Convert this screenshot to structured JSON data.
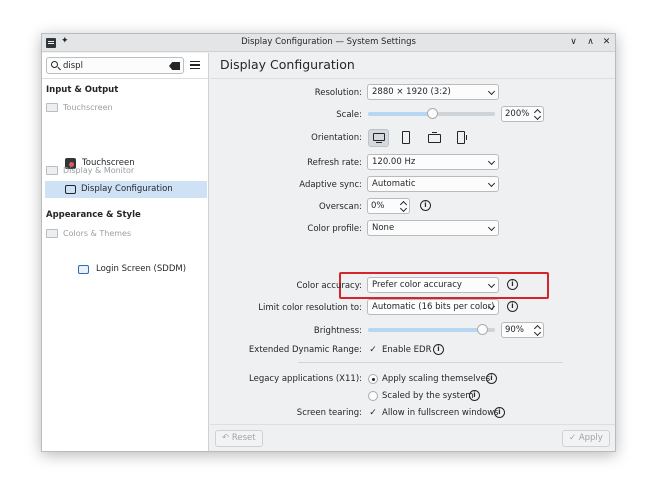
{
  "window": {
    "title": "Display Configuration — System Settings",
    "buttons": {
      "minimize": "∨",
      "maximize": "∧",
      "close": "✕"
    }
  },
  "sidebar": {
    "search_value": "displ",
    "categories": [
      {
        "label": "Input & Output"
      },
      {
        "label": "Appearance & Style"
      }
    ],
    "groups": [
      {
        "label": "Touchscreen"
      },
      {
        "label": "Display & Monitor"
      },
      {
        "label": "Colors & Themes"
      }
    ],
    "items": [
      {
        "label": "Touchscreen"
      },
      {
        "label": "Display Configuration"
      },
      {
        "label": "Login Screen (SDDM)"
      }
    ]
  },
  "main": {
    "page_title": "Display Configuration",
    "labels": {
      "resolution": "Resolution:",
      "scale": "Scale:",
      "orientation": "Orientation:",
      "refresh_rate": "Refresh rate:",
      "adaptive_sync": "Adaptive sync:",
      "overscan": "Overscan:",
      "color_profile": "Color profile:",
      "color_accuracy": "Color accuracy:",
      "limit_color": "Limit color resolution to:",
      "brightness": "Brightness:",
      "hdr": "Extended Dynamic Range:",
      "legacy": "Legacy applications (X11):",
      "tearing": "Screen tearing:"
    },
    "values": {
      "resolution": "2880 × 1920 (3:2)",
      "scale_value": "200%",
      "scale_level": 0.5,
      "refresh_rate": "120.00 Hz",
      "adaptive_sync": "Automatic",
      "overscan": "0%",
      "color_profile": "None",
      "color_accuracy": "Prefer color accuracy",
      "limit_color": "Automatic  (16 bits per color)",
      "brightness_value": "90%",
      "brightness_level": 0.9,
      "hdr_option": "Enable EDR",
      "legacy_option_1": "Apply scaling themselves",
      "legacy_option_2": "Scaled by the system",
      "tearing_option": "Allow in fullscreen windows"
    }
  },
  "footer": {
    "reset": "Reset",
    "apply": "Apply"
  },
  "colors": {
    "selection": "#cfe2f5",
    "highlight_box": "#d6242d",
    "slider_fill": "#b8d6f1"
  }
}
